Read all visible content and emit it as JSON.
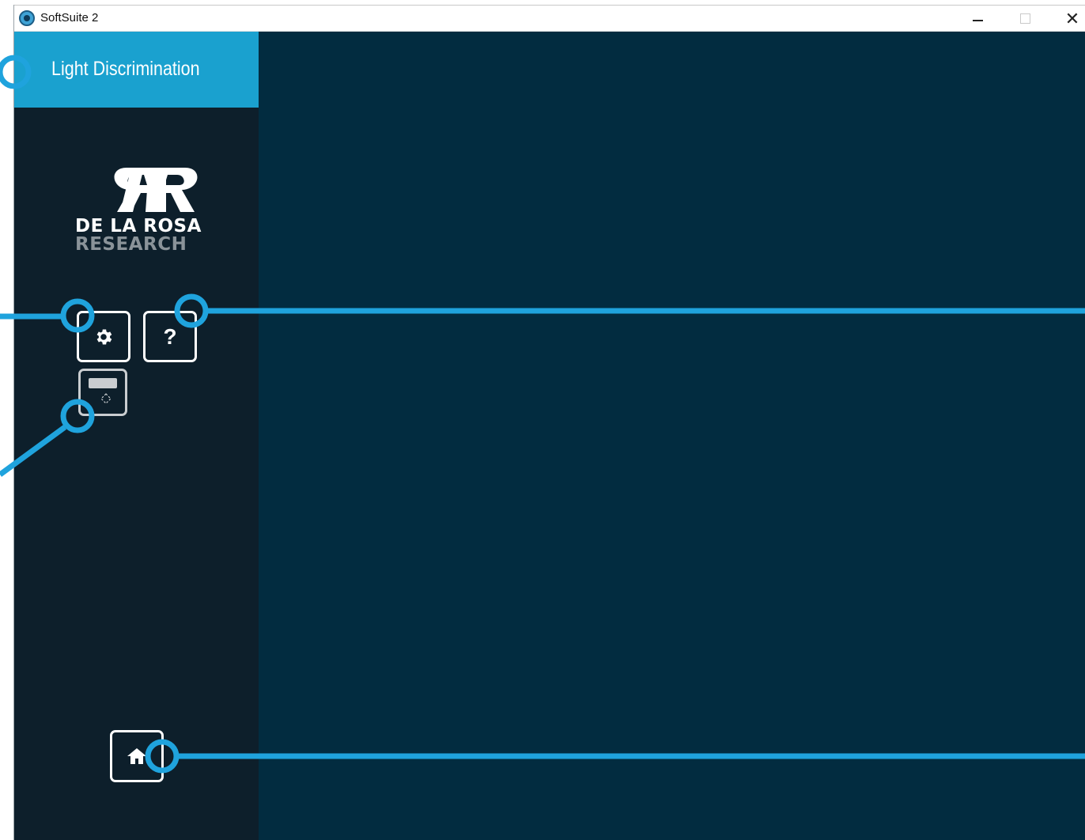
{
  "window": {
    "title": "SoftSuite 2",
    "controls": {
      "minimize": "minimize",
      "maximize": "maximize",
      "close": "✕"
    }
  },
  "sidebar": {
    "header_title": "Light Discrimination",
    "logo": {
      "line1": "DE LA ROSA",
      "line2": "RESEARCH"
    },
    "buttons": {
      "settings": "gear-icon",
      "help": "?",
      "display": "display-toggle-icon",
      "home": "home-icon"
    }
  },
  "colors": {
    "accent": "#1aa1cf",
    "sidebar_bg": "#0d1f2b",
    "main_bg": "#022c40",
    "callout": "#1fa3dd"
  }
}
